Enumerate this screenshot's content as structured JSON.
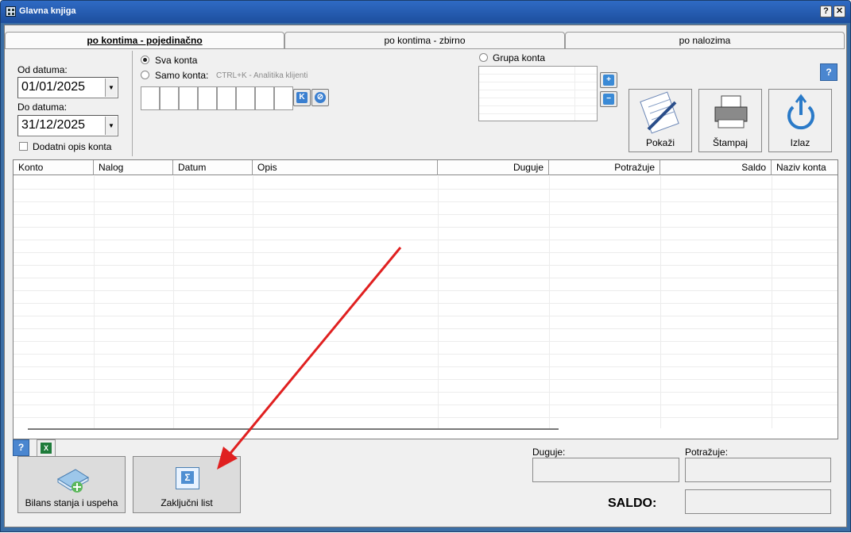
{
  "window": {
    "title": "Glavna knjiga",
    "help_glyph": "?",
    "close_glyph": "✕"
  },
  "tabs": [
    {
      "label": "po kontima - pojedinačno",
      "active": true
    },
    {
      "label": "po kontima - zbirno",
      "active": false
    },
    {
      "label": "po nalozima",
      "active": false
    }
  ],
  "filters": {
    "od_label": "Od datuma:",
    "od_value": "01/01/2025",
    "do_label": "Do datuma:",
    "do_value": "31/12/2025",
    "dodatni_label": "Dodatni opis konta",
    "sva_konta_label": "Sva konta",
    "samo_konta_label": "Samo konta:",
    "hint": "CTRL+K - Analitika klijenti",
    "grupa_label": "Grupa konta",
    "k_btn": "K",
    "plus": "+",
    "minus": "−"
  },
  "actions": {
    "pokazi": "Pokaži",
    "stampaj": "Štampaj",
    "izlaz": "Izlaz",
    "help": "?"
  },
  "table": {
    "columns": [
      "Konto",
      "Nalog",
      "Datum",
      "Opis",
      "Duguje",
      "Potražuje",
      "Saldo",
      "Naziv konta"
    ],
    "rows": []
  },
  "totals": {
    "duguje_label": "Duguje:",
    "potrazuje_label": "Potražuje:",
    "saldo_label": "SALDO:",
    "duguje_value": "",
    "potrazuje_value": "",
    "saldo_value": ""
  },
  "footer": {
    "bilans_label": "Bilans stanja i uspeha",
    "zakljucni_label": "Zaključni list",
    "help": "?",
    "sigma": "Σ"
  },
  "colors": {
    "titlebar": "#1d4f9e",
    "annotation_arrow": "#e02020",
    "accent_blue": "#4a86d0"
  }
}
